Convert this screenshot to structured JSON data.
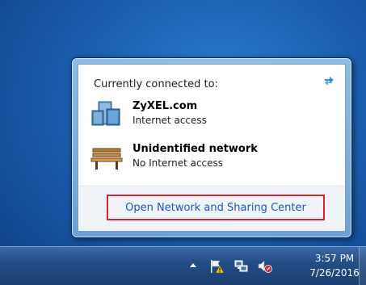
{
  "popup": {
    "heading": "Currently connected to:",
    "networks": [
      {
        "name": "ZyXEL.com",
        "status": "Internet access",
        "icon": "domain-network-icon"
      },
      {
        "name": "Unidentified network",
        "status": "No Internet access",
        "icon": "public-network-bench-icon"
      }
    ],
    "open_center_link": "Open Network and Sharing Center",
    "highlight_color": "#d9232d",
    "link_color": "#1a56c7"
  },
  "taskbar": {
    "tray_icons": [
      "show-hidden-icons-arrow",
      "action-center-flag-warning-icon",
      "network-icon",
      "volume-muted-icon"
    ],
    "time": "3:57 PM",
    "date": "7/26/2016"
  }
}
